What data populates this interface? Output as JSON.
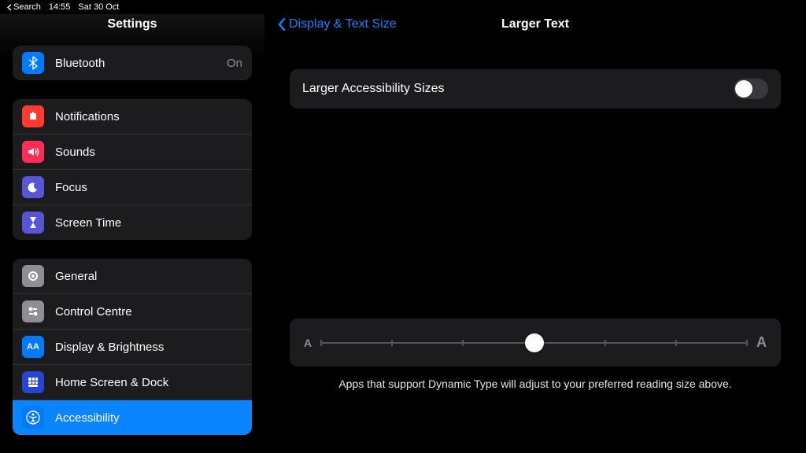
{
  "status_bar": {
    "back_to": "Search",
    "time": "14:55",
    "date": "Sat 30 Oct"
  },
  "sidebar": {
    "title": "Settings",
    "groups": [
      {
        "rows": [
          {
            "name": "bluetooth",
            "label": "Bluetooth",
            "value": "On",
            "icon": "bluetooth-icon"
          }
        ]
      },
      {
        "rows": [
          {
            "name": "notifications",
            "label": "Notifications",
            "icon": "bell-icon"
          },
          {
            "name": "sounds",
            "label": "Sounds",
            "icon": "speaker-icon"
          },
          {
            "name": "focus",
            "label": "Focus",
            "icon": "moon-icon"
          },
          {
            "name": "screen-time",
            "label": "Screen Time",
            "icon": "hourglass-icon"
          }
        ]
      },
      {
        "rows": [
          {
            "name": "general",
            "label": "General",
            "icon": "gear-icon"
          },
          {
            "name": "control-centre",
            "label": "Control Centre",
            "icon": "sliders-icon"
          },
          {
            "name": "display-brightness",
            "label": "Display & Brightness",
            "icon": "text-size-icon"
          },
          {
            "name": "home-screen-dock",
            "label": "Home Screen & Dock",
            "icon": "grid-icon"
          },
          {
            "name": "accessibility",
            "label": "Accessibility",
            "icon": "accessibility-icon",
            "selected": true
          }
        ]
      }
    ]
  },
  "main": {
    "back_label": "Display & Text Size",
    "title": "Larger Text",
    "toggle": {
      "label": "Larger Accessibility Sizes",
      "on": false
    },
    "slider": {
      "min_label": "A",
      "max_label": "A",
      "ticks": 7,
      "position_percent": 50,
      "caption": "Apps that support Dynamic Type will adjust to your preferred reading size above."
    }
  }
}
